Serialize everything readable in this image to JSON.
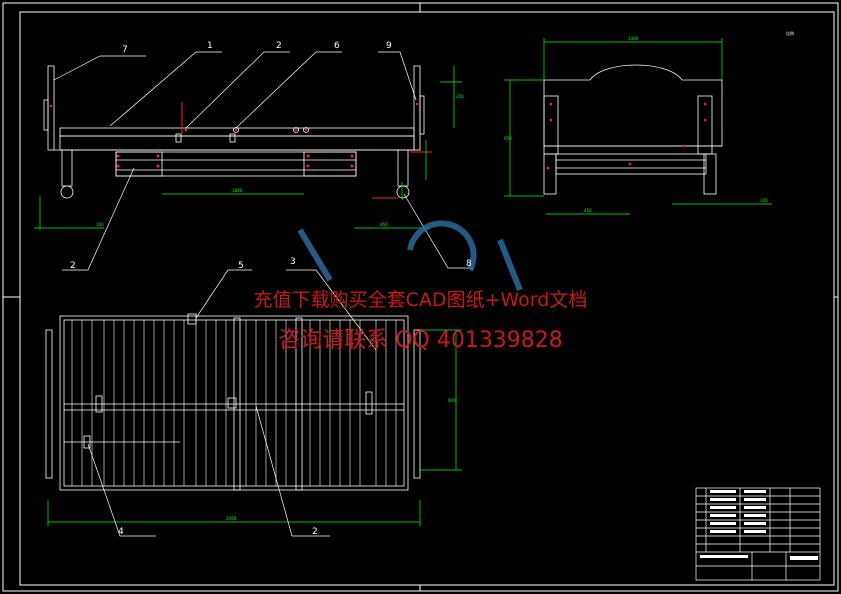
{
  "watermark": {
    "line1": "充值下载购买全套CAD图纸+Word文档",
    "line2": "咨询请联系 QQ 401339828",
    "color": "#c81818"
  },
  "balloons": [
    "7",
    "1",
    "2",
    "6",
    "9",
    "2",
    "5",
    "3",
    "8",
    "4",
    "2"
  ],
  "colors": {
    "background": "#000000",
    "outline": "#ffffff",
    "dimension": "#00ff00",
    "marker": "#ff2020",
    "watermark_logo": "#2a6a9a"
  }
}
